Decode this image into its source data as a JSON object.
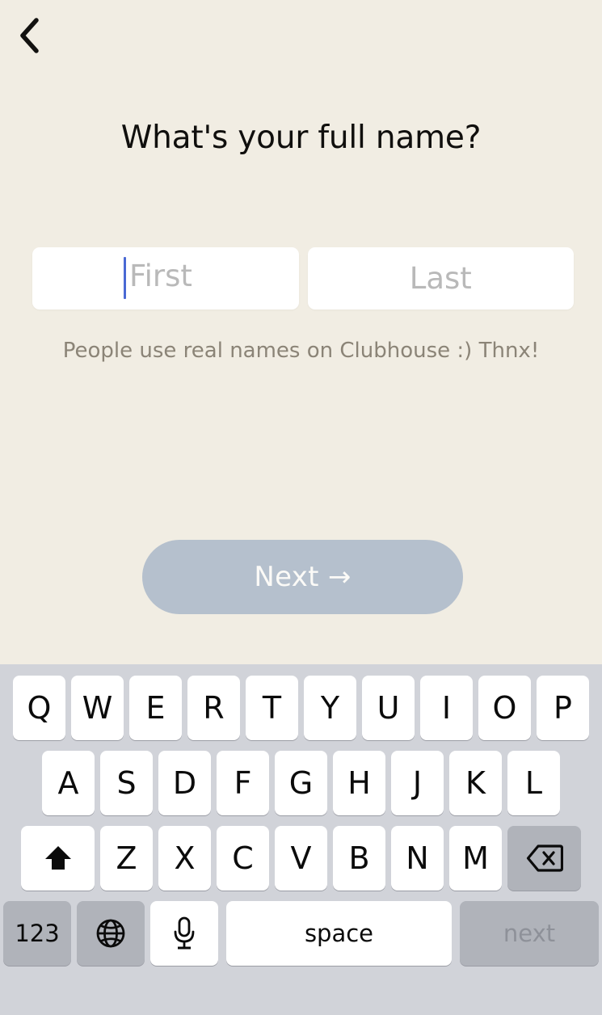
{
  "colors": {
    "background": "#f1ede3",
    "field_background": "#ffffff",
    "caret": "#4a69d4",
    "next_button": "#b5c0cd",
    "keyboard_background": "#d1d3d9",
    "key_white": "#ffffff",
    "key_gray": "#b0b3ba",
    "helper_text": "#8b8477",
    "placeholder_text": "#b9b9b9"
  },
  "nav": {
    "back_icon": "chevron-left-icon"
  },
  "header": {
    "title": "What's your full name?"
  },
  "form": {
    "first_name": {
      "value": "",
      "placeholder": "First",
      "focused": true
    },
    "last_name": {
      "value": "",
      "placeholder": "Last",
      "focused": false
    },
    "helper_text": "People use real names on Clubhouse :) Thnx!"
  },
  "actions": {
    "next_label": "Next →"
  },
  "keyboard": {
    "row1": [
      "Q",
      "W",
      "E",
      "R",
      "T",
      "Y",
      "U",
      "I",
      "O",
      "P"
    ],
    "row2": [
      "A",
      "S",
      "D",
      "F",
      "G",
      "H",
      "J",
      "K",
      "L"
    ],
    "row3_letters": [
      "Z",
      "X",
      "C",
      "V",
      "B",
      "N",
      "M"
    ],
    "shift_icon": "shift-arrow-up-icon",
    "backspace_icon": "backspace-delete-icon",
    "numbers_label": "123",
    "globe_icon": "globe-language-icon",
    "mic_icon": "microphone-icon",
    "space_label": "space",
    "next_label": "next"
  }
}
